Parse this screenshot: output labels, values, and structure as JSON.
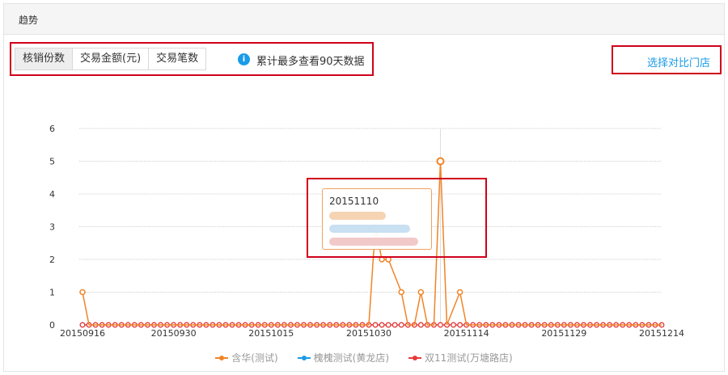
{
  "panel": {
    "title": "趋势"
  },
  "tabs": [
    {
      "label": "核销份数",
      "active": true
    },
    {
      "label": "交易金额(元)",
      "active": false
    },
    {
      "label": "交易笔数",
      "active": false
    }
  ],
  "info": {
    "icon": "info-icon",
    "text": "累计最多查看90天数据"
  },
  "compare_link": "选择对比门店",
  "tooltip": {
    "title": "20151110"
  },
  "colors": {
    "orange": "#f08427",
    "blue": "#1a9be8",
    "red": "#e53a3a",
    "accent_frame": "#d0001b"
  },
  "chart_data": {
    "type": "line",
    "ylim": [
      0,
      6
    ],
    "yticks": [
      "0",
      "1",
      "2",
      "3",
      "4",
      "5",
      "6"
    ],
    "xticks": [
      "20150916",
      "20150930",
      "20151015",
      "20151030",
      "20151114",
      "20151129",
      "20151214"
    ],
    "grid": true,
    "legend_position": "bottom",
    "series": [
      {
        "name": "含华(测试)",
        "color": "#f08427",
        "points": [
          [
            "20150916",
            1
          ],
          [
            "20150917",
            0
          ],
          [
            "20151030",
            0
          ],
          [
            "20151031",
            3
          ],
          [
            "20151101",
            2
          ],
          [
            "20151102",
            2
          ],
          [
            "20151104",
            1
          ],
          [
            "20151105",
            0
          ],
          [
            "20151106",
            0
          ],
          [
            "20151107",
            1
          ],
          [
            "20151108",
            0
          ],
          [
            "20151109",
            0
          ],
          [
            "20151110",
            5
          ],
          [
            "20151111",
            0
          ],
          [
            "20151113",
            1
          ],
          [
            "20151114",
            0
          ],
          [
            "20151214",
            0
          ]
        ]
      },
      {
        "name": "槐槐测试(黄龙店)",
        "color": "#1a9be8",
        "points": []
      },
      {
        "name": "双11测试(万塘路店)",
        "color": "#e53a3a",
        "points": "all-zero"
      }
    ]
  }
}
